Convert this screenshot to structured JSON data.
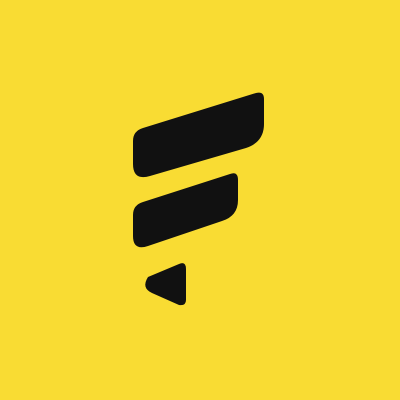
{
  "background_color": "#f9dc33",
  "logo": {
    "icon": "stacked-f-logo-icon",
    "color": "#111111"
  }
}
